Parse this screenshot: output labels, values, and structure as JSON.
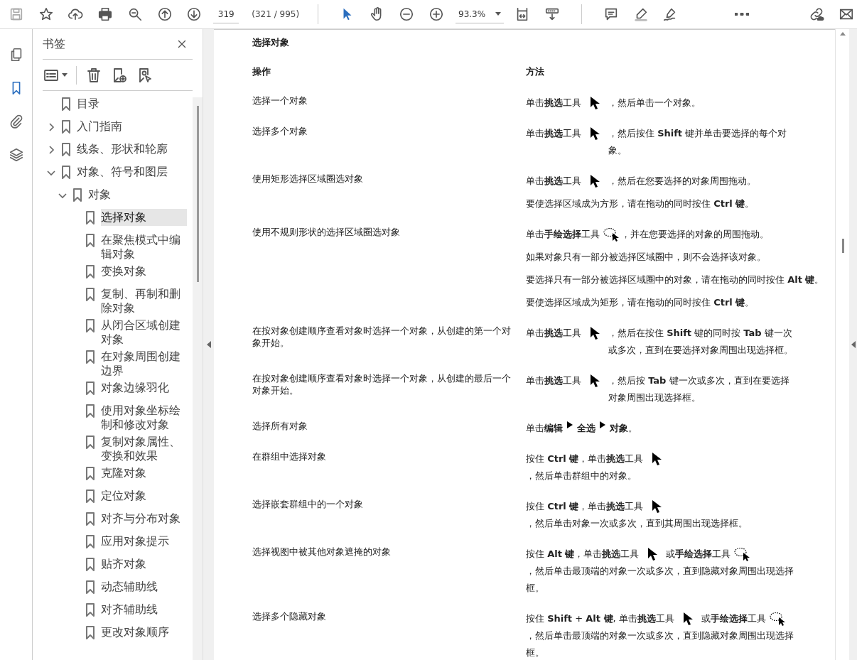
{
  "toolbar": {
    "page_field": {
      "value": "319"
    },
    "page_count": "(321 / 995)",
    "tools": [
      {
        "kind": "select",
        "selected": true
      },
      {
        "kind": "hand",
        "selected": false
      }
    ],
    "zoom": {
      "value": "93.3%"
    }
  },
  "rail": [
    {
      "kind": "pages",
      "selected": false
    },
    {
      "kind": "bookmarks",
      "selected": true
    },
    {
      "kind": "attachments",
      "selected": false
    },
    {
      "kind": "layers",
      "selected": false
    }
  ],
  "bookmarks": {
    "title": "书签",
    "items": [
      {
        "label": "目录",
        "selected": false
      },
      {
        "label": "入门指南",
        "selected": false,
        "expanded": false
      },
      {
        "label": "线条、形状和轮廓",
        "selected": false,
        "expanded": false
      },
      {
        "label": "对象、符号和图层",
        "selected": false,
        "expanded": true,
        "children": [
          {
            "label": "对象",
            "selected": false,
            "expanded": true,
            "children": [
              {
                "label": "选择对象",
                "selected": true
              },
              {
                "label": "在聚焦模式中编辑对象",
                "selected": false
              },
              {
                "label": "变换对象",
                "selected": false
              },
              {
                "label": "复制、再制和删除对象",
                "selected": false
              },
              {
                "label": "从闭合区域创建对象",
                "selected": false
              },
              {
                "label": "在对象周围创建边界",
                "selected": false
              },
              {
                "label": "对象边缘羽化",
                "selected": false
              },
              {
                "label": "使用对象坐标绘制和修改对象",
                "selected": false
              },
              {
                "label": "复制对象属性、变换和效果",
                "selected": false
              },
              {
                "label": "克隆对象",
                "selected": false
              },
              {
                "label": "定位对象",
                "selected": false
              },
              {
                "label": "对齐与分布对象",
                "selected": false
              },
              {
                "label": "应用对象提示",
                "selected": false
              },
              {
                "label": "贴齐对象",
                "selected": false
              },
              {
                "label": "动态辅助线",
                "selected": false
              },
              {
                "label": "对齐辅助线",
                "selected": false
              },
              {
                "label": "更改对象顺序",
                "selected": false
              }
            ]
          }
        ]
      }
    ]
  },
  "document": {
    "title": "选择对象",
    "columns": [
      "操作",
      "方法"
    ],
    "rows": [
      {
        "action": "选择一个对象",
        "method": [
          [
            {
              "kind": "text",
              "text": "单击**挑选**工具"
            },
            {
              "kind": "pointer"
            },
            {
              "kind": "text",
              "text": "，然后单击一个对象。"
            }
          ]
        ]
      },
      {
        "action": "选择多个对象",
        "method": [
          [
            {
              "kind": "text",
              "text": "单击**挑选**工具"
            },
            {
              "kind": "pointer"
            },
            {
              "kind": "text",
              "text": "，然后按住 **Shift** 键并单击要选择的每个对象。"
            }
          ]
        ]
      },
      {
        "action": "使用矩形选择区域圈选对象",
        "method": [
          [
            {
              "kind": "text",
              "text": "单击**挑选**工具"
            },
            {
              "kind": "pointer"
            },
            {
              "kind": "text",
              "text": "，然后在您要选择的对象周围拖动。"
            }
          ],
          [
            {
              "kind": "text",
              "text": "要使选择区域成为方形，请在拖动的同时按住 **Ctrl 键**。"
            }
          ]
        ]
      },
      {
        "action": "使用不规则形状的选择区域圈选对象",
        "method": [
          [
            {
              "kind": "text",
              "text": "单击**手绘选择**工具"
            },
            {
              "kind": "lasso"
            },
            {
              "kind": "text",
              "text": "，并在您要选择的对象的周围拖动。"
            }
          ],
          [
            {
              "kind": "text",
              "text": "如果对象只有一部分被选择区域圈中，则不会选择该对象。"
            }
          ],
          [
            {
              "kind": "text",
              "text": "要选择只有一部分被选择区域圈中的对象，请在拖动的同时按住 **Alt 键**。"
            }
          ],
          [
            {
              "kind": "text",
              "text": "要使选择区域成为矩形，请在拖动的同时按住 **Ctrl 键**。"
            }
          ]
        ]
      },
      {
        "action": "在按对象创建顺序查看对象时选择一个对象，从创建的第一个对象开始。",
        "method": [
          [
            {
              "kind": "text",
              "text": "单击**挑选**工具"
            },
            {
              "kind": "pointer"
            },
            {
              "kind": "text",
              "text": "，然后在按住 **Shift** 键的同时按 **Tab** 键一次或多次，直到在要选择对象周围出现选择框。"
            }
          ]
        ]
      },
      {
        "action": "在按对象创建顺序查看对象时选择一个对象，从创建的最后一个对象开始。",
        "method": [
          [
            {
              "kind": "text",
              "text": "单击**挑选**工具"
            },
            {
              "kind": "pointer"
            },
            {
              "kind": "text",
              "text": "，然后按 **Tab** 键一次或多次，直到在要选择对象周围出现选择框。"
            }
          ]
        ]
      },
      {
        "action": "选择所有对象",
        "method": [
          [
            {
              "kind": "text",
              "text": "单击**编辑**"
            },
            {
              "kind": "menu-arrow"
            },
            {
              "kind": "text",
              "text": "全选",
              "bold": true
            },
            {
              "kind": "menu-arrow"
            },
            {
              "kind": "text",
              "text": "**对象**。"
            }
          ]
        ]
      },
      {
        "action": "在群组中选择对象",
        "method": [
          [
            {
              "kind": "text",
              "text": "按住 **Ctrl 键**，单击**挑选**工具"
            },
            {
              "kind": "pointer"
            },
            {
              "kind": "text",
              "text": "，然后单击群组中的对象。"
            }
          ]
        ]
      },
      {
        "action": "选择嵌套群组中的一个对象",
        "method": [
          [
            {
              "kind": "text",
              "text": "按住 **Ctrl 键**，单击**挑选**工具"
            },
            {
              "kind": "pointer"
            },
            {
              "kind": "text",
              "text": "，然后单击对象一次或多次，直到其周围出现选择框。"
            }
          ]
        ]
      },
      {
        "action": "选择视图中被其他对象遮掩的对象",
        "method": [
          [
            {
              "kind": "text",
              "text": "按住 **Alt 键**，单击**挑选**工具"
            },
            {
              "kind": "pointer"
            },
            {
              "kind": "text",
              "text": "或**手绘选择**工具"
            },
            {
              "kind": "lasso"
            },
            {
              "kind": "text",
              "text": "，然后单击最顶端的对象一次或多次，直到隐藏对象周围出现选择框。"
            }
          ]
        ]
      },
      {
        "action": "选择多个隐藏对象",
        "method": [
          [
            {
              "kind": "text",
              "text": "按住 **Shift** + **Alt 键**, 单击**挑选**工具"
            },
            {
              "kind": "pointer"
            },
            {
              "kind": "text",
              "text": "或**手绘选择**工具"
            },
            {
              "kind": "lasso"
            },
            {
              "kind": "text",
              "text": "，然后单击最顶端的对象一次或多次，直到隐藏对象周围出现选择框。"
            }
          ]
        ]
      }
    ]
  }
}
